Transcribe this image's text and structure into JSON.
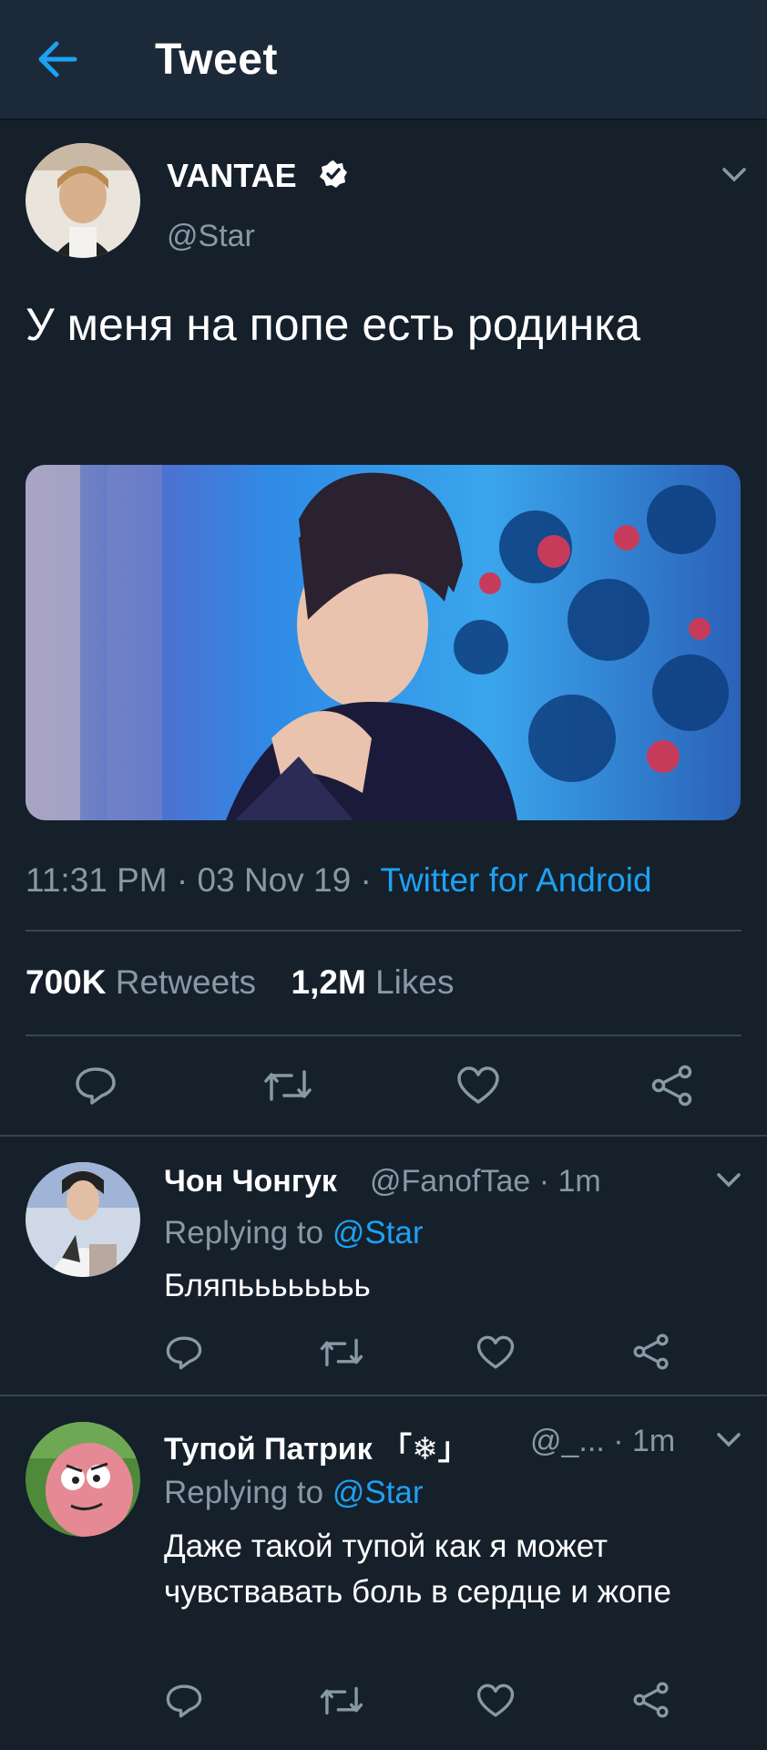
{
  "header": {
    "title": "Tweet"
  },
  "tweet": {
    "author_name": "VANTAE",
    "author_handle": "@Star",
    "text": "У меня на попе есть родинка",
    "time": "11:31 PM · 03 Nov 19 · ",
    "source": "Twitter for Android",
    "retweets_count": "700K",
    "retweets_label": "Retweets",
    "likes_count": "1,2M",
    "likes_label": "Likes"
  },
  "replies": [
    {
      "name": "Чон Чонгук",
      "handle": "@FanofTae · 1m",
      "replying_prefix": "Replying to ",
      "replying_to": "@Star",
      "text": "Бляпьььььььь"
    },
    {
      "name": "Тупой Патрик 「❄」",
      "handle": "@_... · 1m",
      "replying_prefix": "Replying to ",
      "replying_to": "@Star",
      "text": "Даже такой тупой как я может чувствавать боль в сердце и жопе"
    }
  ],
  "colors": {
    "background": "#15202b",
    "header": "#1c2938",
    "accent": "#1da1f2",
    "muted": "#8899a6",
    "divider": "#38444d"
  },
  "icons": [
    "back-arrow-icon",
    "verified-badge-icon",
    "chevron-down-icon",
    "reply-icon",
    "retweet-icon",
    "like-icon",
    "share-icon"
  ]
}
